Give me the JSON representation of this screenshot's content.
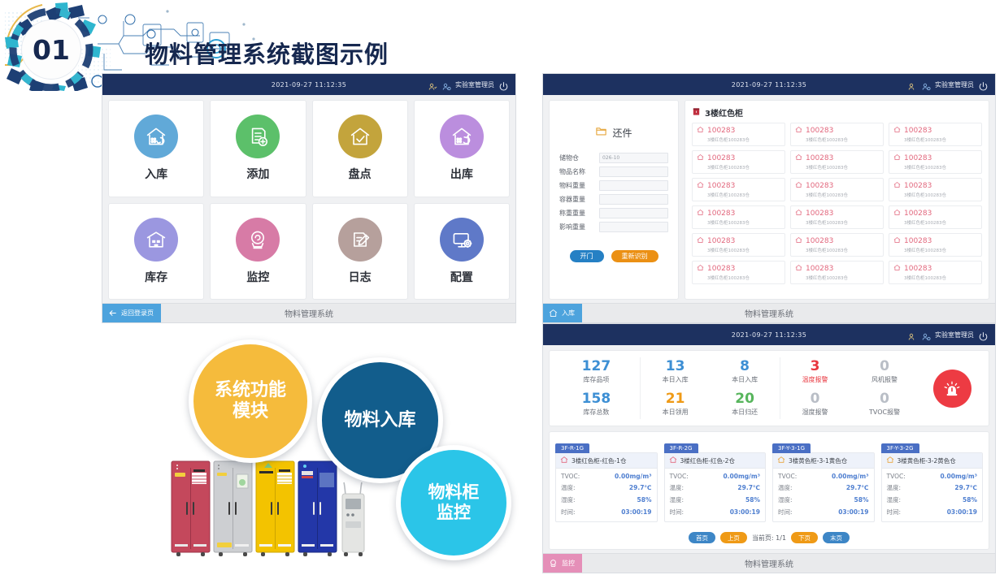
{
  "header": {
    "badge_number": "01",
    "title": "物料管理系统截图示例"
  },
  "topbar": {
    "timestamp": "2021-09-27  11:12:35",
    "user_name": "实验室管理员",
    "user_icon": "user-icon",
    "user_switch_icon": "user-switch-icon",
    "power_icon": "power-icon"
  },
  "footer": {
    "system_name": "物料管理系统",
    "back_label": "返回登录页",
    "back_icon": "arrow-left-icon",
    "inbound_chip": "入库",
    "inbound_icon": "warehouse-in-icon",
    "monitor_chip": "监控",
    "monitor_icon": "camera-icon"
  },
  "menu": {
    "tiles": [
      {
        "label": "入库",
        "icon": "warehouse-in-icon",
        "color": "#61a9d8"
      },
      {
        "label": "添加",
        "icon": "document-add-icon",
        "color": "#5cc06a"
      },
      {
        "label": "盘点",
        "icon": "check-house-icon",
        "color": "#c3a43c"
      },
      {
        "label": "出库",
        "icon": "warehouse-out-icon",
        "color": "#bb8ede"
      },
      {
        "label": "库存",
        "icon": "inventory-house-icon",
        "color": "#9b97e0"
      },
      {
        "label": "监控",
        "icon": "camera-icon",
        "color": "#d77ba6"
      },
      {
        "label": "日志",
        "icon": "log-pencil-icon",
        "color": "#b6a09c"
      },
      {
        "label": "配置",
        "icon": "monitor-gear-icon",
        "color": "#5f79c8"
      }
    ]
  },
  "inbound": {
    "form_title": "还件",
    "form_title_icon": "folder-icon",
    "fields": [
      {
        "label": "储物仓",
        "value": "026-10",
        "placeholder": ""
      },
      {
        "label": "物品名称",
        "value": "",
        "placeholder": ""
      },
      {
        "label": "物料重量",
        "value": "",
        "placeholder": ""
      },
      {
        "label": "容器重量",
        "value": "",
        "placeholder": ""
      },
      {
        "label": "称重重量",
        "value": "",
        "placeholder": ""
      },
      {
        "label": "影响重量",
        "value": "",
        "placeholder": ""
      }
    ],
    "open_door_label": "开门",
    "rescan_label": "重新识别",
    "list_title": "3楼红色柜",
    "list_title_icon": "cabinet-icon",
    "cells": [
      {
        "id": "100283",
        "sub": "3楼红色柜100283仓",
        "icon": "bin-icon"
      },
      {
        "id": "100283",
        "sub": "3楼红色柜100283仓",
        "icon": "bin-icon"
      },
      {
        "id": "100283",
        "sub": "3楼红色柜100283仓",
        "icon": "bin-icon"
      },
      {
        "id": "100283",
        "sub": "3楼红色柜100283仓",
        "icon": "bin-icon"
      },
      {
        "id": "100283",
        "sub": "3楼红色柜100283仓",
        "icon": "bin-icon"
      },
      {
        "id": "100283",
        "sub": "3楼红色柜100283仓",
        "icon": "bin-icon"
      },
      {
        "id": "100283",
        "sub": "3楼红色柜100283仓",
        "icon": "bin-icon"
      },
      {
        "id": "100283",
        "sub": "3楼红色柜100283仓",
        "icon": "bin-icon"
      },
      {
        "id": "100283",
        "sub": "3楼红色柜100283仓",
        "icon": "bin-icon"
      },
      {
        "id": "100283",
        "sub": "3楼红色柜100283仓",
        "icon": "bin-icon"
      },
      {
        "id": "100283",
        "sub": "3楼红色柜100283仓",
        "icon": "bin-icon"
      },
      {
        "id": "100283",
        "sub": "3楼红色柜100283仓",
        "icon": "bin-icon"
      },
      {
        "id": "100283",
        "sub": "3楼红色柜100283仓",
        "icon": "bin-icon"
      },
      {
        "id": "100283",
        "sub": "3楼红色柜100283仓",
        "icon": "bin-icon"
      },
      {
        "id": "100283",
        "sub": "3楼红色柜100283仓",
        "icon": "bin-icon"
      },
      {
        "id": "100283",
        "sub": "3楼红色柜100283仓",
        "icon": "bin-icon"
      },
      {
        "id": "100283",
        "sub": "3楼红色柜100283仓",
        "icon": "bin-icon"
      },
      {
        "id": "100283",
        "sub": "3楼红色柜100283仓",
        "icon": "bin-icon"
      }
    ]
  },
  "monitor": {
    "stats_group_1": [
      {
        "value": "127",
        "label": "库存品项",
        "color": "#3d8fd4"
      },
      {
        "value": "158",
        "label": "库存总数",
        "color": "#3d8fd4"
      }
    ],
    "stats_group_2": [
      {
        "value": "13",
        "label": "本日入库",
        "color": "#3d8fd4"
      },
      {
        "value": "21",
        "label": "本日领用",
        "color": "#ef9a16"
      }
    ],
    "stats_group_3": [
      {
        "value": "8",
        "label": "本日入库",
        "color": "#3d8fd4"
      },
      {
        "value": "20",
        "label": "本日归还",
        "color": "#57b55c"
      }
    ],
    "stats_group_4": [
      {
        "value": "3",
        "label": "温度报警",
        "color": "#e8373f",
        "label_color": "#e8373f"
      },
      {
        "value": "0",
        "label": "湿度报警",
        "color": "#b9bec6",
        "label_color": "#6b7079"
      }
    ],
    "stats_group_5": [
      {
        "value": "0",
        "label": "风机报警",
        "color": "#b9bec6",
        "label_color": "#6b7079"
      },
      {
        "value": "0",
        "label": "TVOC报警",
        "color": "#b9bec6",
        "label_color": "#6b7079"
      }
    ],
    "alarm_icon": "siren-alarm-icon",
    "cabinets": [
      {
        "tag": "3F-R-1G",
        "name": "3楼红色柜-红色-1仓",
        "icon": "house-red-icon",
        "rows": [
          {
            "key": "TVOC:",
            "value": "0.00mg/m³"
          },
          {
            "key": "温度:",
            "value": "29.7℃"
          },
          {
            "key": "湿度:",
            "value": "58%"
          },
          {
            "key": "时间:",
            "value": "03:00:19"
          }
        ]
      },
      {
        "tag": "3F-R-2G",
        "name": "3楼红色柜-红色-2仓",
        "icon": "house-red-icon",
        "rows": [
          {
            "key": "TVOC:",
            "value": "0.00mg/m³"
          },
          {
            "key": "温度:",
            "value": "29.7℃"
          },
          {
            "key": "湿度:",
            "value": "58%"
          },
          {
            "key": "时间:",
            "value": "03:00:19"
          }
        ]
      },
      {
        "tag": "3F-Y-3-1G",
        "name": "3楼黄色柜-3-1黄色仓",
        "icon": "house-yellow-icon",
        "rows": [
          {
            "key": "TVOC:",
            "value": "0.00mg/m³"
          },
          {
            "key": "温度:",
            "value": "29.7℃"
          },
          {
            "key": "湿度:",
            "value": "58%"
          },
          {
            "key": "时间:",
            "value": "03:00:19"
          }
        ]
      },
      {
        "tag": "3F-Y-3-2G",
        "name": "3楼黄色柜-3-2黄色仓",
        "icon": "house-yellow-icon",
        "rows": [
          {
            "key": "TVOC:",
            "value": "0.00mg/m³"
          },
          {
            "key": "温度:",
            "value": "29.7℃"
          },
          {
            "key": "湿度:",
            "value": "58%"
          },
          {
            "key": "时间:",
            "value": "03:00:19"
          }
        ]
      }
    ],
    "pager": {
      "first": "首页",
      "prev": "上页",
      "current": "当前页: 1/1",
      "next": "下页",
      "last": "末页"
    }
  },
  "callouts": [
    {
      "line1": "系统功能",
      "line2": "模块",
      "color": "#f5bb3c"
    },
    {
      "line1": "物料入库",
      "line2": "",
      "color": "#125d8c"
    },
    {
      "line1": "物料柜",
      "line2": "监控",
      "color": "#2bc5e8"
    }
  ],
  "photo": {
    "alt": "material-cabinets-photo",
    "cabinet_colors": [
      "#c4485c",
      "#cdcfd2",
      "#f3c300",
      "#2337a8",
      "#e4e5e3"
    ]
  }
}
